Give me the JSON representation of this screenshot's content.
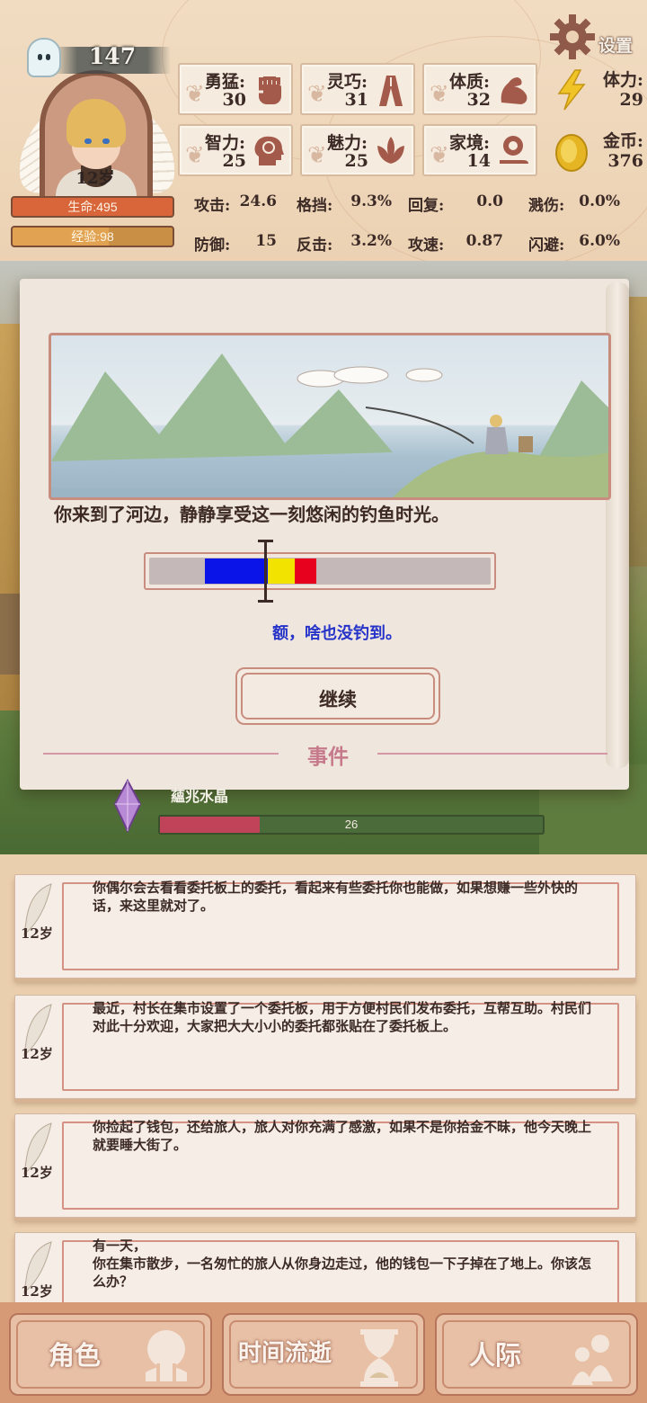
{
  "header": {
    "power": "147",
    "age": "12岁",
    "hp_label": "生命:495",
    "xp_label": "经验:98",
    "settings_label": "设置"
  },
  "attributes": [
    {
      "name": "勇猛:",
      "value": "30",
      "icon": "fist-icon"
    },
    {
      "name": "灵巧:",
      "value": "31",
      "icon": "cloak-icon"
    },
    {
      "name": "体质:",
      "value": "32",
      "icon": "muscle-arm-icon"
    },
    {
      "name": "智力:",
      "value": "25",
      "icon": "brain-head-icon"
    },
    {
      "name": "魅力:",
      "value": "25",
      "icon": "lotus-icon"
    },
    {
      "name": "家境:",
      "value": "14",
      "icon": "coin-hand-icon"
    }
  ],
  "resources": {
    "stamina": {
      "name": "体力:",
      "value": "29",
      "icon": "lightning-icon"
    },
    "gold": {
      "name": "金币:",
      "value": "376",
      "icon": "gold-coin-icon"
    }
  },
  "combat_stats": [
    {
      "name": "攻击:",
      "value": "24.6"
    },
    {
      "name": "格挡:",
      "value": "9.3%"
    },
    {
      "name": "回复:",
      "value": "0.0"
    },
    {
      "name": "溅伤:",
      "value": "0.0%"
    },
    {
      "name": "防御:",
      "value": "15"
    },
    {
      "name": "反击:",
      "value": "3.2%"
    },
    {
      "name": "攻速:",
      "value": "0.87"
    },
    {
      "name": "闪避:",
      "value": "6.0%"
    }
  ],
  "event": {
    "title": "事件",
    "description": "你来到了河边，静静享受这一刻悠闲的钓鱼时光。",
    "result": "额，啥也没钓到。",
    "continue_label": "继续",
    "fishing_colors": {
      "track": "#c4b8b8",
      "zone_blue": "#0a14e8",
      "zone_yellow": "#f2e400",
      "zone_red": "#e8001f"
    }
  },
  "crystal": {
    "name": "蘊兆水晶",
    "value": "26",
    "fill_fraction": 0.26
  },
  "log": [
    {
      "age": "12岁",
      "text": "你偶尔会去看看委托板上的委托，看起来有些委托你也能做，如果想赚一些外快的话，来这里就对了。"
    },
    {
      "age": "12岁",
      "text": "最近，村长在集市设置了一个委托板，用于方便村民们发布委托，互帮互助。村民们对此十分欢迎，大家把大大小小的委托都张贴在了委托板上。"
    },
    {
      "age": "12岁",
      "text": "你捡起了钱包，还给旅人，旅人对你充满了感激，如果不是你拾金不昧，他今天晚上就要睡大街了。"
    },
    {
      "age": "12岁",
      "text": "有一天，\n你在集市散步，一名匆忙的旅人从你身边走过，他的钱包一下子掉在了地上。你该怎么办？"
    }
  ],
  "nav": [
    {
      "label": "角色",
      "icon": "character-bust-icon"
    },
    {
      "label": "时间流逝",
      "icon": "hourglass-icon"
    },
    {
      "label": "人际",
      "icon": "people-icon"
    }
  ],
  "colors": {
    "accent": "#c88d7e",
    "hp": "#d9653a",
    "xp": "#e1a352",
    "result_text": "#2633c9"
  }
}
